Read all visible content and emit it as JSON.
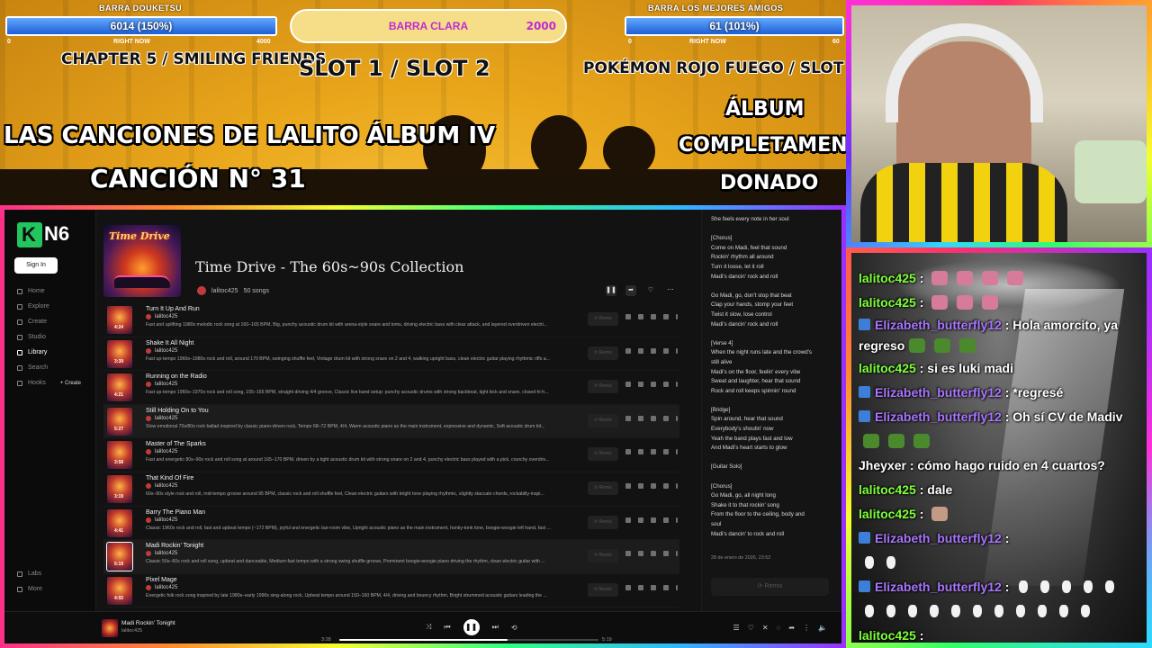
{
  "overlay": {
    "bar_left": {
      "title": "BARRA DOUKETSU",
      "value": "6014 (150%)",
      "min": "0",
      "sub": "RIGHT NOW",
      "max": "4000",
      "fill_percent": 100
    },
    "bar_center": {
      "title": "BARRA CLARA",
      "value": "2000",
      "fill_percent": 100
    },
    "bar_right": {
      "title": "BARRA LOS MEJORES AMIGOS",
      "value": "61 (101%)",
      "min": "0",
      "sub": "RIGHT NOW",
      "max": "60",
      "fill_percent": 100
    },
    "chapter_label": "CHAPTER 5 / SMILING FRIENDS",
    "slot_label": "SLOT 1 / SLOT 2",
    "pokemon_label": "POKÉMON ROJO FUEGO / SLOT 4",
    "headline_line1": "LAS CANCIONES DE LALITO ÁLBUM IV",
    "headline_line2": "CANCIÓN N° 31",
    "donated_line1": "ÁLBUM",
    "donated_line2": "COMPLETAMENTE",
    "donated_line3": "DONADO"
  },
  "app": {
    "logo_text": "N6",
    "logo_letter": "K",
    "sign_in": "Sign In",
    "nav": [
      {
        "label": "Home"
      },
      {
        "label": "Explore"
      },
      {
        "label": "Create"
      },
      {
        "label": "Studio"
      },
      {
        "label": "Library"
      },
      {
        "label": "Search"
      },
      {
        "label": "Hooks"
      }
    ],
    "create_pill": "+ Create",
    "nav_bottom": [
      {
        "label": "Labs"
      },
      {
        "label": "More"
      }
    ],
    "cover_title": "Time Drive",
    "playlist_title": "Time Drive - The 60s~90s Collection",
    "owner": "lalitoc425",
    "song_count": "50 songs",
    "remix_label": "Remix",
    "songs": [
      {
        "title": "Turn It Up And Run",
        "artist": "lalitoc425",
        "duration": "4:24",
        "desc": "Fast and uplifting 1980s melodic rock song at 160–165 BPM, Big, punchy acoustic drum kit with arena-style snare and toms, driving electric bass with clear attack, and layered overdriven electri..."
      },
      {
        "title": "Shake It All Night",
        "artist": "lalitoc425",
        "duration": "3:39",
        "desc": "Fast up-tempo 1960s–1980s rock and roll, around 170 BPM, swinging shuffle feel, Vintage drum kit with strong snare on 2 and 4, walking upright bass, clean electric guitar playing rhythmic riffs a..."
      },
      {
        "title": "Running on the Radio",
        "artist": "lalitoc425",
        "duration": "4:21",
        "desc": "Fast up-tempo 1960s–1970s rock and roll song, 155–165 BPM, straight driving 4/4 groove, Classic live band setup: punchy acoustic drums with strong backbeat, tight kick and snare, closed hi-h..."
      },
      {
        "title": "Still Holding On to You",
        "artist": "lalitoc425",
        "duration": "5:27",
        "desc": "Slow emotional 70s/80s rock ballad inspired by classic piano-driven rock, Tempo 68–72 BPM, 4/4, Warm acoustic piano as the main instrument, expressive and dynamic, Soft acoustic drum kit..."
      },
      {
        "title": "Master of The Sparks",
        "artist": "lalitoc425",
        "duration": "3:58",
        "desc": "Fast and energetic 80s–90s rock and roll song at around 165–170 BPM, driven by a tight acoustic drum kit with strong snare on 2 and 4, punchy electric bass played with a pick, crunchy overdriv..."
      },
      {
        "title": "That Kind Of Fire",
        "artist": "lalitoc425",
        "duration": "3:19",
        "desc": "60s–90s style rock and roll, mid-tempo groove around 95 BPM, classic rock and roll shuffle feel, Clean electric guitars with bright tone playing rhythmic, slightly staccato chords, rockabilly-inspi..."
      },
      {
        "title": "Barry The Piano Man",
        "artist": "lalitoc425",
        "duration": "4:41",
        "desc": "Classic 1960s rock and roll, fast and upbeat tempo (~172 BPM), joyful and energetic bar-room vibe, Upright acoustic piano as the main instrument, honky-tonk tone, boogie-woogie left hand, fast ..."
      },
      {
        "title": "Madi Rockin' Tonight",
        "artist": "lalitoc425",
        "duration": "5:19",
        "desc": "Classic 50s–60s rock and roll song, upbeat and danceable, Medium-fast tempo with a strong swing shuffle groove, Prominent boogie-woogie piano driving the rhythm, clean electric guitar with ..."
      },
      {
        "title": "Pixel Mage",
        "artist": "lalitoc425",
        "duration": "4:55",
        "desc": "Energetic folk rock song inspired by late 1980s–early 1990s sing-along rock, Upbeat tempo around 150–160 BPM, 4/4, driving and bouncy rhythm, Bright strummed acoustic guitars leading the ..."
      }
    ],
    "lyrics": [
      "She feels every note in her soul",
      "",
      "[Chorus]",
      "Come on Madi, feel that sound",
      "Rockin' rhythm all around",
      "Turn it loose, let it roll",
      "Madi's dancin' rock and roll",
      "",
      "Go Madi, go, don't stop that beat",
      "Clap your hands, stomp your feet",
      "Twist it slow, lose control",
      "Madi's dancin' rock and roll",
      "",
      "[Verse 4]",
      "When the night runs late and the crowd's",
      "still alive",
      "Madi's on the floor, feelin' every vibe",
      "Sweat and laughter, hear that sound",
      "Rock and roll keeps spinnin' round",
      "",
      "[Bridge]",
      "Spin around, hear that sound",
      "Everybody's shoutin' now",
      "Yeah the band plays fast and low",
      "And Madi's heart starts to glow",
      "",
      "[Guitar Solo]",
      "",
      "[Chorus]",
      "Go Madi, go, all night long",
      "Shake it to that rockin' song",
      "From the floor to the ceiling, body and",
      "soul",
      "Madi's dancin' to rock and roll"
    ],
    "lyrics_date": "28 de enero de 2026, 23:52",
    "lyrics_remix": "Remix",
    "player": {
      "title": "Madi Rockin' Tonight",
      "artist": "lalitoc425",
      "time_elapsed": "3:28",
      "time_total": "5:19",
      "progress_fraction": 0.65
    }
  },
  "chat": [
    {
      "user": "lalitoc425",
      "sep": " :",
      "text": "",
      "emotes": 4,
      "color": "green"
    },
    {
      "user": "lalitoc425",
      "sep": " :",
      "text": "",
      "emotes": 3,
      "color": "green"
    },
    {
      "user": "Elizabeth_butterfly12",
      "sep": " :",
      "text": "Hola amorcito, ya regreso",
      "emotes": 3,
      "color": "purple",
      "badge": true
    },
    {
      "user": "lalitoc425",
      "sep": " :",
      "text": "si es luki madi",
      "color": "green"
    },
    {
      "user": "Elizabeth_butterfly12",
      "sep": " :",
      "text": "*regresé",
      "color": "purple",
      "badge": true
    },
    {
      "user": "Elizabeth_butterfly12",
      "sep": " :",
      "text": "Oh sí CV de Madiv",
      "color": "purple",
      "badge": true
    },
    {
      "user": "Jheyxer",
      "sep": " :",
      "text": "cómo hago ruido en 4 cuartos?",
      "color": "white"
    },
    {
      "user": "lalitoc425",
      "sep": " :",
      "text": "dale",
      "color": "green"
    },
    {
      "user": "lalitoc425",
      "sep": " :",
      "text": "",
      "emotes": 1,
      "color": "green"
    },
    {
      "user": "Elizabeth_butterfly12",
      "sep": " :",
      "text": "",
      "color": "purple",
      "badge": true
    },
    {
      "user": "Elizabeth_butterfly12",
      "sep": " :",
      "text": "",
      "color": "purple",
      "badge": true
    },
    {
      "user": "lalitoc425",
      "sep": " :",
      "text": "",
      "color": "green"
    }
  ],
  "colors": {
    "accent_green": "#22c55e",
    "chat_green": "#7dff3a",
    "chat_purple": "#a975ff",
    "bar_blue": "#1f5fd6"
  }
}
